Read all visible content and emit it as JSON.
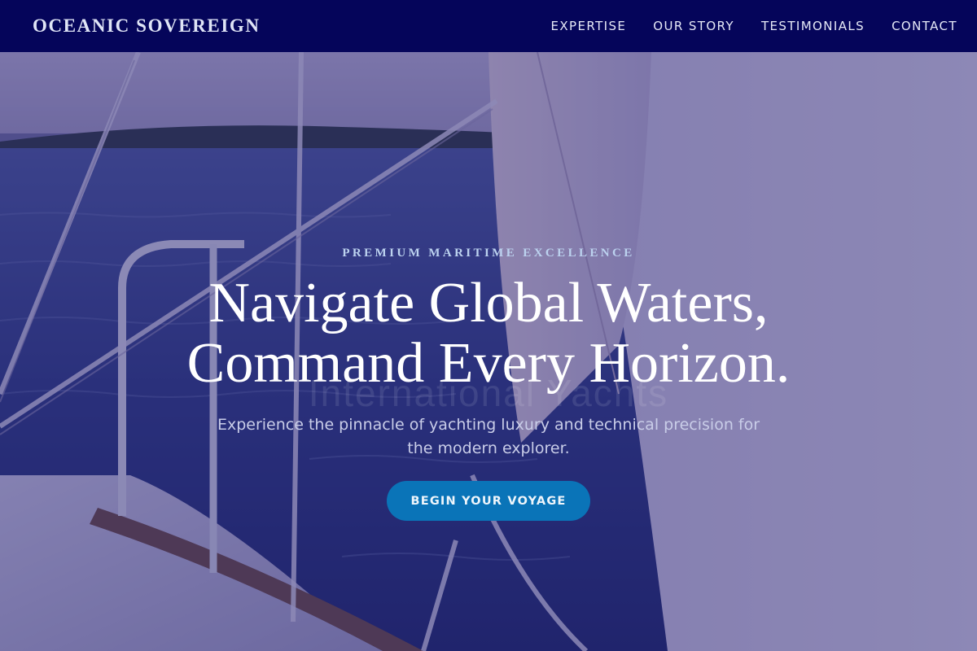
{
  "header": {
    "brand": "OCEANIC SOVEREIGN",
    "nav": [
      "EXPERTISE",
      "OUR STORY",
      "TESTIMONIALS",
      "CONTACT"
    ]
  },
  "hero": {
    "eyebrow": "PREMIUM MARITIME EXCELLENCE",
    "headline_line1": "Navigate Global Waters,",
    "headline_line2": "Command Every Horizon.",
    "ghost_text": "International Yachts",
    "subtext": "Experience the pinnacle of yachting luxury and technical precision for the modern explorer.",
    "cta_label": "BEGIN YOUR VOYAGE"
  },
  "colors": {
    "header_bg": "#05055a",
    "overlay": "#26227a",
    "cta": "#0a74b8",
    "eyebrow": "#bcd2ef"
  }
}
